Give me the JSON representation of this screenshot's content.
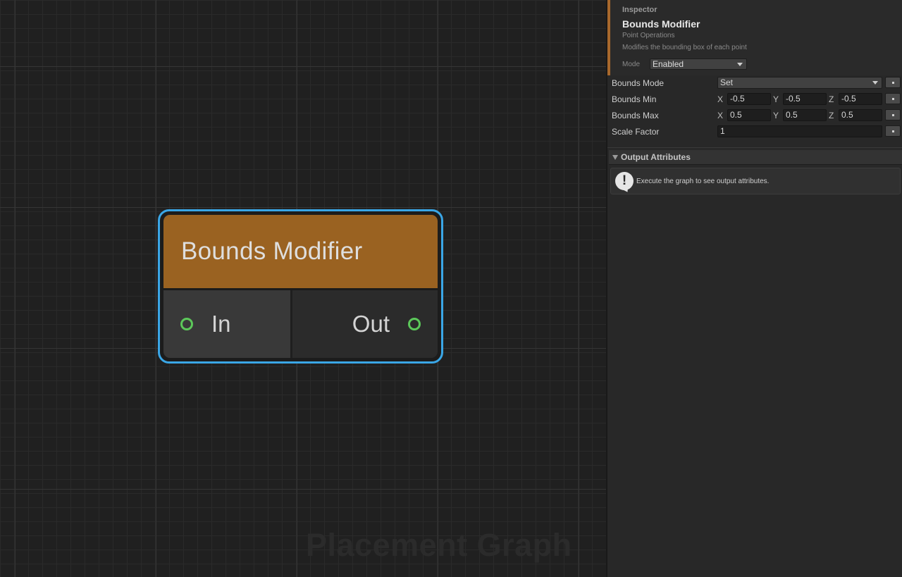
{
  "graph": {
    "watermark": "Placement Graph",
    "node": {
      "title": "Bounds Modifier",
      "input_port": "In",
      "output_port": "Out"
    }
  },
  "inspector": {
    "heading": "Inspector",
    "title": "Bounds Modifier",
    "subtitle": "Point Operations",
    "description": "Modifies the bounding box of each point",
    "mode_label": "Mode",
    "mode_value": "Enabled",
    "properties": {
      "bounds_mode": {
        "label": "Bounds Mode",
        "value": "Set"
      },
      "bounds_min": {
        "label": "Bounds Min",
        "x": "-0.5",
        "y": "-0.5",
        "z": "-0.5"
      },
      "bounds_max": {
        "label": "Bounds Max",
        "x": "0.5",
        "y": "0.5",
        "z": "0.5"
      },
      "scale_factor": {
        "label": "Scale Factor",
        "value": "1"
      }
    },
    "axis_labels": {
      "x": "X",
      "y": "Y",
      "z": "Z"
    },
    "output_section": {
      "title": "Output Attributes",
      "message": "Execute the graph to see output attributes."
    }
  },
  "colors": {
    "node_header": "#9a6221",
    "selection_outline": "#3aa6e6",
    "port_connector": "#5cc85a",
    "inspector_accent": "#a8682c"
  },
  "icons": {
    "dropdown": "chevron-down-icon",
    "reset": "reset-dot-icon",
    "section_toggle": "triangle-down-icon",
    "info": "exclamation-speech-icon"
  }
}
